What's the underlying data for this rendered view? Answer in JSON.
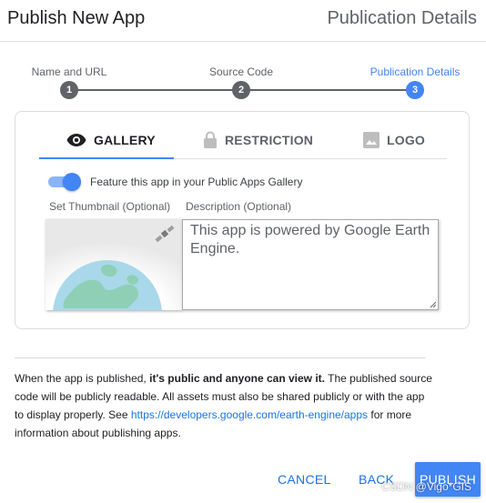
{
  "header": {
    "title": "Publish New App",
    "subtitle": "Publication Details"
  },
  "stepper": {
    "steps": [
      {
        "label": "Name and URL",
        "number": "1",
        "active": false
      },
      {
        "label": "Source Code",
        "number": "2",
        "active": false
      },
      {
        "label": "Publication Details",
        "number": "3",
        "active": true
      }
    ]
  },
  "tabs": [
    {
      "label": "GALLERY",
      "icon": "eye-icon",
      "active": true
    },
    {
      "label": "RESTRICTION",
      "icon": "lock-icon",
      "active": false
    },
    {
      "label": "LOGO",
      "icon": "image-icon",
      "active": false
    }
  ],
  "gallery": {
    "toggle_on": true,
    "toggle_label": "Feature this app in your Public Apps Gallery",
    "thumbnail_label": "Set Thumbnail (Optional)",
    "description_label": "Description (Optional)",
    "description_value": "This app is powered by Google Earth Engine."
  },
  "info": {
    "part1": "When the app is published, ",
    "bold": "it's public and anyone can view it.",
    "part2": " The published source code will be publicly readable. All assets must also be shared publicly or with the app to display properly. See ",
    "link": "https://developers.google.com/earth-engine/apps",
    "part3": " for more information about publishing apps."
  },
  "actions": {
    "cancel": "CANCEL",
    "back": "BACK",
    "publish": "PUBLISH"
  },
  "watermark": "CSDN @Vigo*GIS",
  "colors": {
    "accent": "#4285f4",
    "link": "#1a73e8",
    "step_inactive": "#5f6368"
  }
}
